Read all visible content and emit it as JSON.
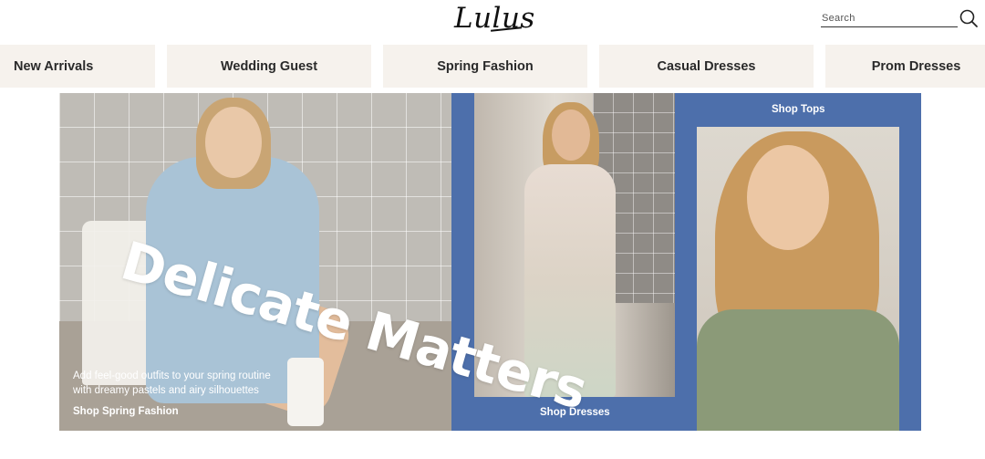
{
  "header": {
    "logo_text": "Lulus",
    "search_placeholder": "Search",
    "search_icon": "magnifier-icon"
  },
  "nav": {
    "items": [
      {
        "label": "New Arrivals"
      },
      {
        "label": "Wedding Guest"
      },
      {
        "label": "Spring Fashion"
      },
      {
        "label": "Casual Dresses"
      },
      {
        "label": "Prom Dresses"
      }
    ]
  },
  "hero": {
    "headline": "Delicate Matters",
    "subtext_line1": "Add feel-good outfits to your spring routine",
    "subtext_line2": "with dreamy pastels and airy silhouettes",
    "cta_spring": "Shop Spring Fashion",
    "cta_dresses": "Shop Dresses",
    "cta_tops": "Shop Tops"
  },
  "colors": {
    "nav_background": "#f6f2ed",
    "hero_panel_blue": "#4d6fab",
    "text_dark": "#2a2a2a"
  }
}
